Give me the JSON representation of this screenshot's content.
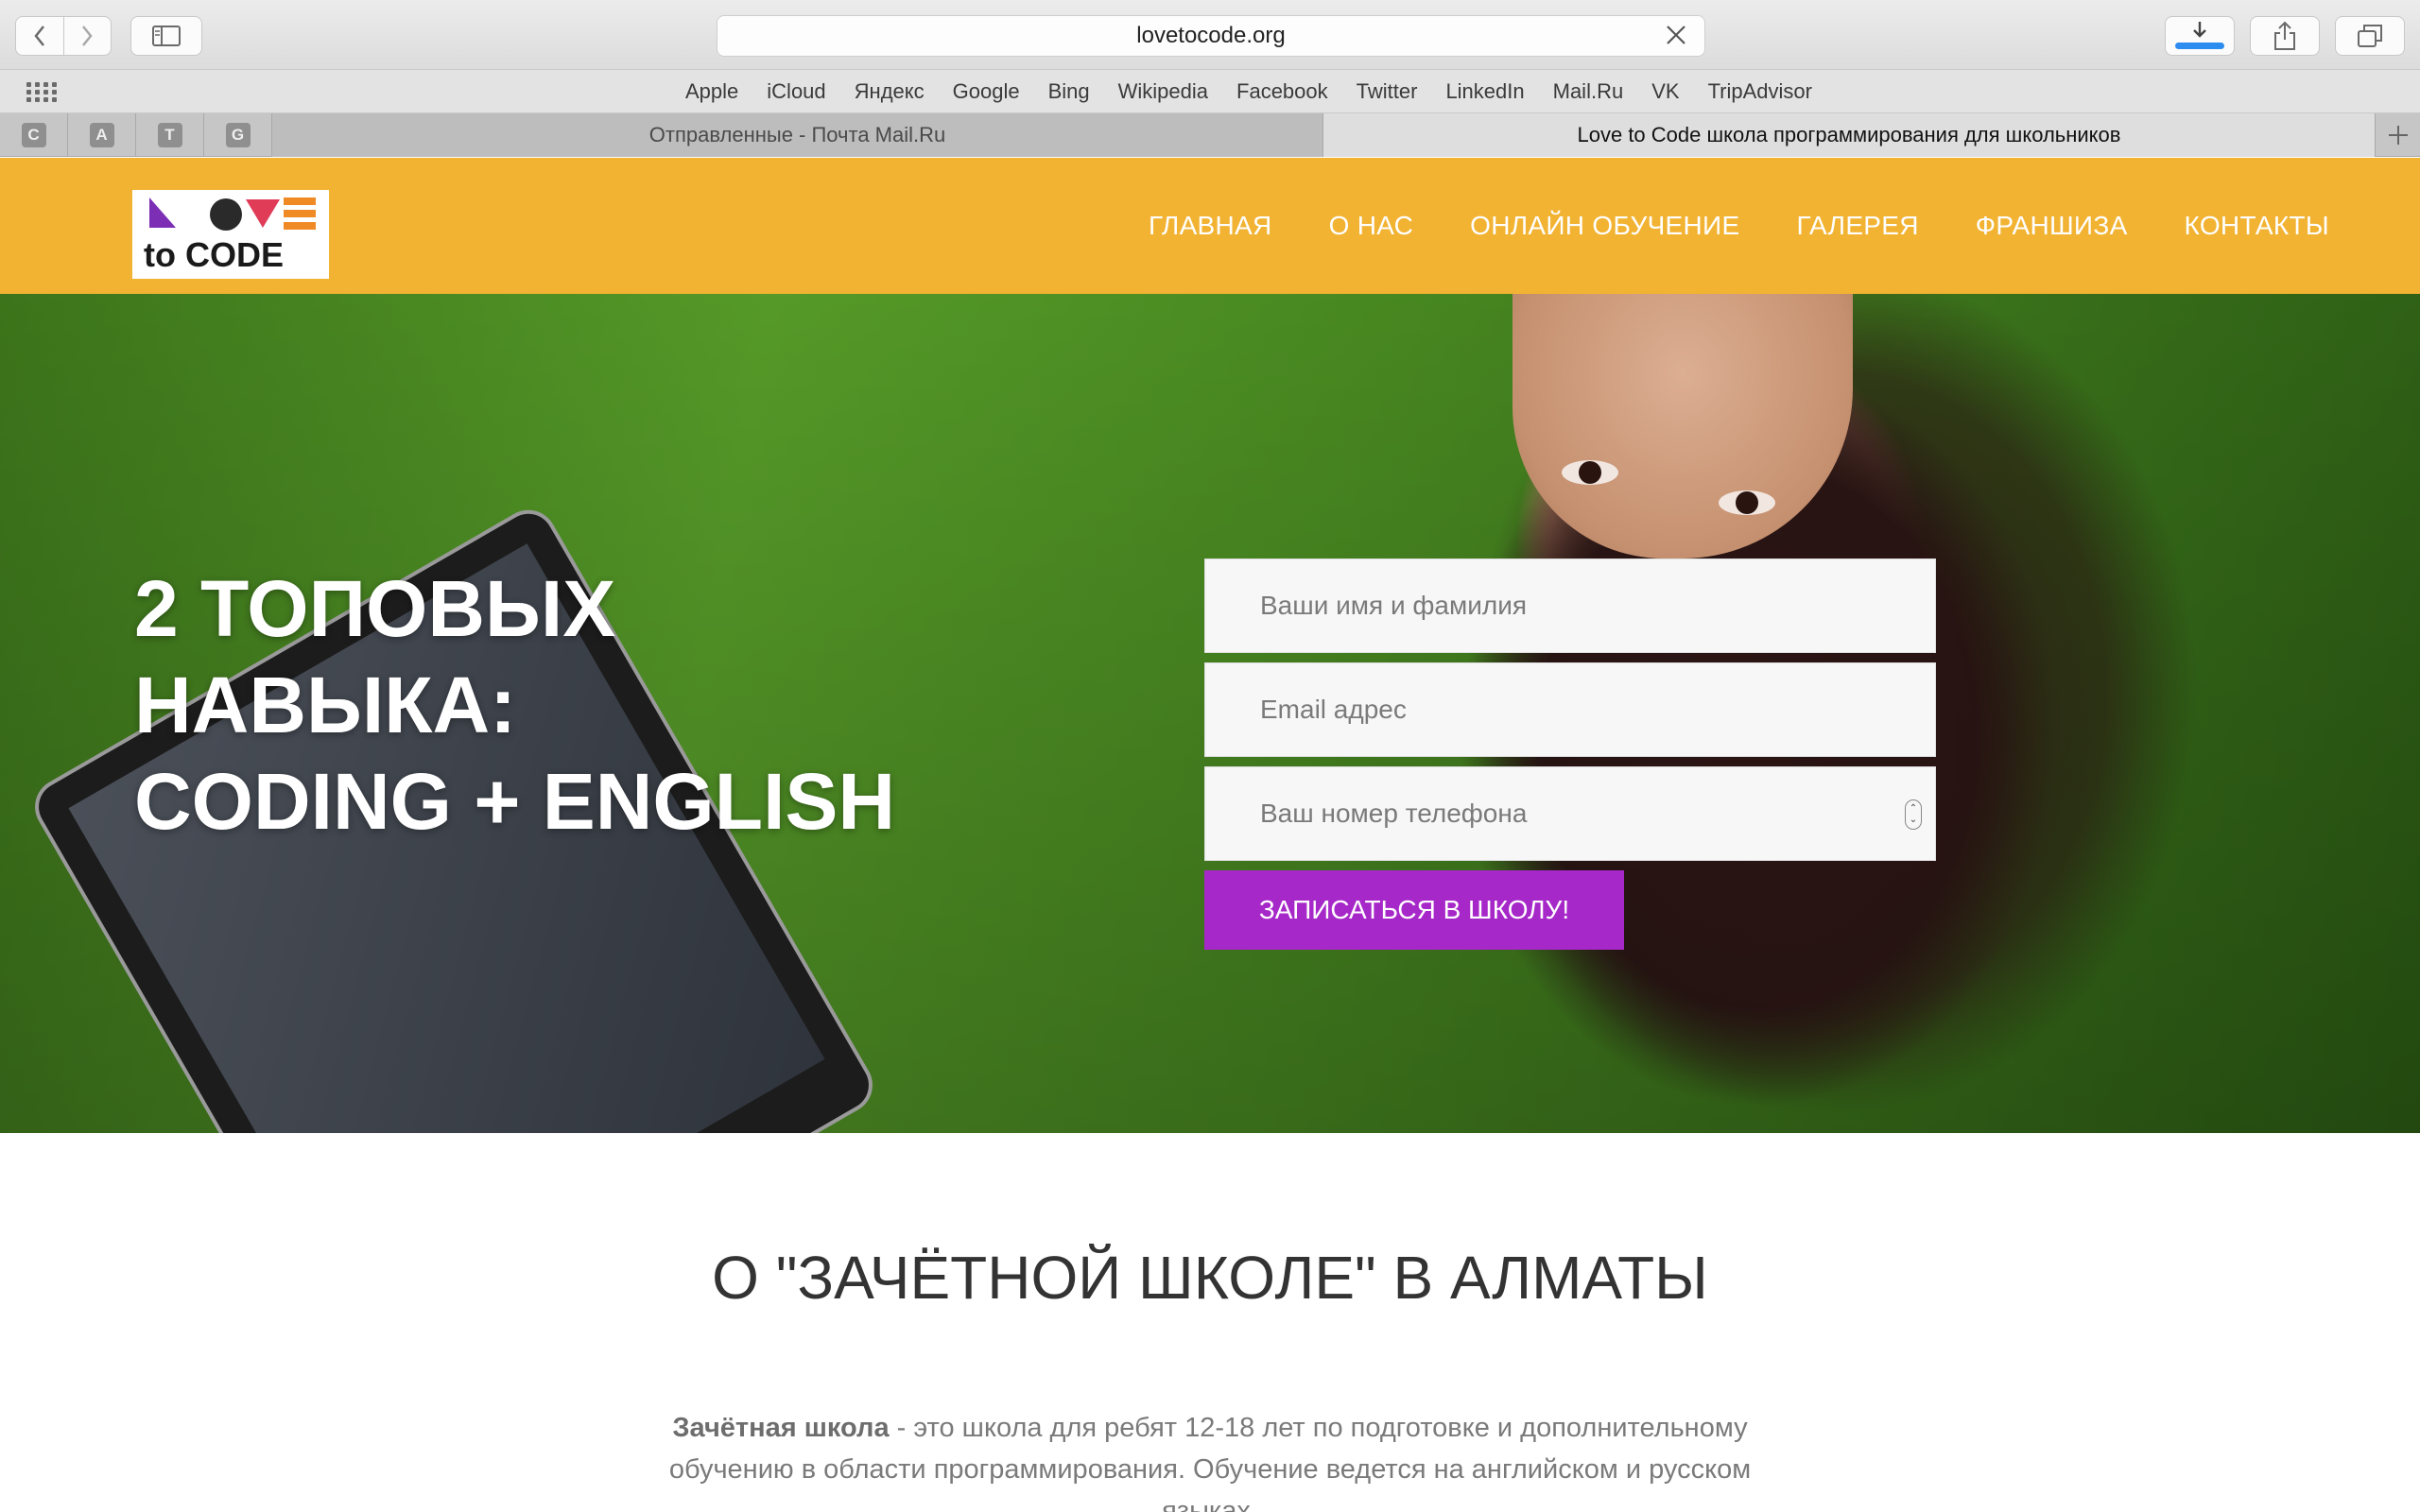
{
  "browser": {
    "url": "lovetocode.org",
    "favorites": [
      "Apple",
      "iCloud",
      "Яндекс",
      "Google",
      "Bing",
      "Wikipedia",
      "Facebook",
      "Twitter",
      "LinkedIn",
      "Mail.Ru",
      "VK",
      "TripAdvisor"
    ],
    "pinned_tabs": [
      "C",
      "A",
      "T",
      "G"
    ],
    "tabs": [
      {
        "title": "Отправленные - Почта Mail.Ru",
        "active": false
      },
      {
        "title": "Love to Code школа программирования для школьников",
        "active": true
      }
    ]
  },
  "site": {
    "logo": {
      "top": "LOVE",
      "bottom": "to CODE"
    },
    "nav": [
      "ГЛАВНАЯ",
      "О НАС",
      "ОНЛАЙН ОБУЧЕНИЕ",
      "ГАЛЕРЕЯ",
      "ФРАНШИЗА",
      "КОНТАКТЫ"
    ],
    "header_color": "#f2b333",
    "accent_color": "#a728c9"
  },
  "hero": {
    "title_lines": [
      "2 ТОПОВЫХ",
      "НАВЫКА:",
      "CODING + ENGLISH"
    ],
    "form": {
      "name_placeholder": "Ваши имя и фамилия",
      "email_placeholder": "Email адрес",
      "phone_placeholder": "Ваш номер телефона",
      "submit_label": "Записаться в школу!"
    }
  },
  "about": {
    "title": "О \"ЗАЧЁТНОЙ ШКОЛЕ\" В АЛМАТЫ",
    "text_bold": "Зачётная школа",
    "text_rest": " - это школа для ребят 12-18 лет по подготовке и дополнительному обучению в области программирования. Обучение ведется на английском и русском языках."
  }
}
